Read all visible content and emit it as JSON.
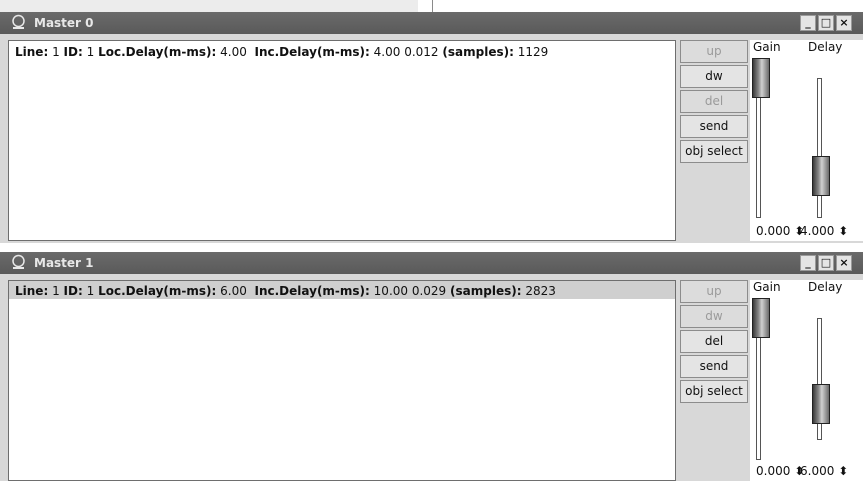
{
  "windows": [
    {
      "title": "Master 0",
      "controls": {
        "minimize": "_",
        "maximize": "□",
        "close": "×"
      },
      "info": {
        "line_label": "Line:",
        "line_value": "1",
        "id_label": "ID:",
        "id_value": "1",
        "loc_delay_label": "Loc.Delay(m-ms):",
        "loc_delay_value": "4.00",
        "inc_delay_label": "Inc.Delay(m-ms):",
        "inc_delay_value": "4.00 0.012",
        "samples_label": "(samples):",
        "samples_value": "1129"
      },
      "buttons": [
        {
          "label": "up",
          "enabled": false
        },
        {
          "label": "dw",
          "enabled": true
        },
        {
          "label": "del",
          "enabled": false
        },
        {
          "label": "send",
          "enabled": true
        },
        {
          "label": "obj select",
          "enabled": true
        }
      ],
      "gain": {
        "label": "Gain",
        "value": "0.000"
      },
      "delay": {
        "label": "Delay",
        "value": "4.000"
      }
    },
    {
      "title": "Master 1",
      "controls": {
        "minimize": "_",
        "maximize": "□",
        "close": "×"
      },
      "info": {
        "line_label": "Line:",
        "line_value": "1",
        "id_label": "ID:",
        "id_value": "1",
        "loc_delay_label": "Loc.Delay(m-ms):",
        "loc_delay_value": "6.00",
        "inc_delay_label": "Inc.Delay(m-ms):",
        "inc_delay_value": "10.00 0.029",
        "samples_label": "(samples):",
        "samples_value": "2823"
      },
      "buttons": [
        {
          "label": "up",
          "enabled": false
        },
        {
          "label": "dw",
          "enabled": false
        },
        {
          "label": "del",
          "enabled": true
        },
        {
          "label": "send",
          "enabled": true
        },
        {
          "label": "obj select",
          "enabled": true
        }
      ],
      "gain": {
        "label": "Gain",
        "value": "0.000"
      },
      "delay": {
        "label": "Delay",
        "value": "6.000"
      }
    }
  ]
}
